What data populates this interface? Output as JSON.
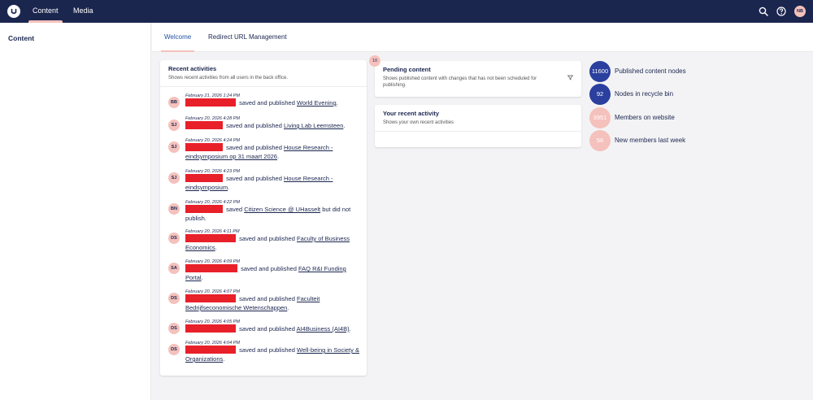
{
  "topbar": {
    "nav": [
      {
        "label": "Content"
      },
      {
        "label": "Media"
      }
    ],
    "user_initials": "NB",
    "colors": {
      "bar": "#1b264f",
      "accent": "#f5c1bc"
    }
  },
  "sidebar": {
    "title": "Content"
  },
  "tabs": [
    {
      "label": "Welcome"
    },
    {
      "label": "Redirect URL Management"
    }
  ],
  "recent_activities": {
    "title": "Recent activities",
    "subtitle": "Shows recent activities from all users in the back office.",
    "items": [
      {
        "initials": "BB",
        "time": "February 21, 2026 1:24 PM",
        "action": "saved and published",
        "link": "World Evening",
        "suffix": "."
      },
      {
        "initials": "SJ",
        "time": "February 20, 2026 4:28 PM",
        "action": "saved and published",
        "link": "Living Lab Leemsteen",
        "suffix": "."
      },
      {
        "initials": "SJ",
        "time": "February 20, 2026 4:24 PM",
        "action": "saved and published",
        "link": "House Research - eindsymposium op 31 maart 2026",
        "suffix": "."
      },
      {
        "initials": "SJ",
        "time": "February 20, 2026 4:23 PM",
        "action": "saved and published",
        "link": "House Research - eindsymposium",
        "suffix": "."
      },
      {
        "initials": "BN",
        "time": "February 20, 2026 4:22 PM",
        "action": "saved",
        "link": "Citizen Science @ UHasselt",
        "suffix": " but did not publish."
      },
      {
        "initials": "DS",
        "time": "February 20, 2026 4:11 PM",
        "action": "saved and published",
        "link": "Faculty of Business Economics",
        "suffix": "."
      },
      {
        "initials": "SA",
        "time": "February 20, 2026 4:09 PM",
        "action": "saved and published",
        "link": "FAQ R&I Funding Portal",
        "suffix": "."
      },
      {
        "initials": "DS",
        "time": "February 20, 2026 4:07 PM",
        "action": "saved and published",
        "link": "Faculteit Bedrijfseconomische Wetenschappen",
        "suffix": "."
      },
      {
        "initials": "DS",
        "time": "February 20, 2026 4:05 PM",
        "action": "saved and published",
        "link": "AI4Business (AI4B)",
        "suffix": "."
      },
      {
        "initials": "DS",
        "time": "February 20, 2026 4:04 PM",
        "action": "saved and published",
        "link": "Well-being in Society & Organizations",
        "suffix": "."
      }
    ]
  },
  "pending_content": {
    "badge": "10",
    "title": "Pending content",
    "subtitle": "Shows published content with changes that has not been scheduled for publishing."
  },
  "your_recent_activity": {
    "title": "Your recent activity",
    "subtitle": "Shows your own recent activities"
  },
  "stats": [
    {
      "value": "11600",
      "label": "Published content nodes",
      "style": "dark"
    },
    {
      "value": "92",
      "label": "Nodes in recycle bin",
      "style": "dark"
    },
    {
      "value": "3951",
      "label": "Members on website",
      "style": "light"
    },
    {
      "value": "56",
      "label": "New members last week",
      "style": "light"
    }
  ]
}
